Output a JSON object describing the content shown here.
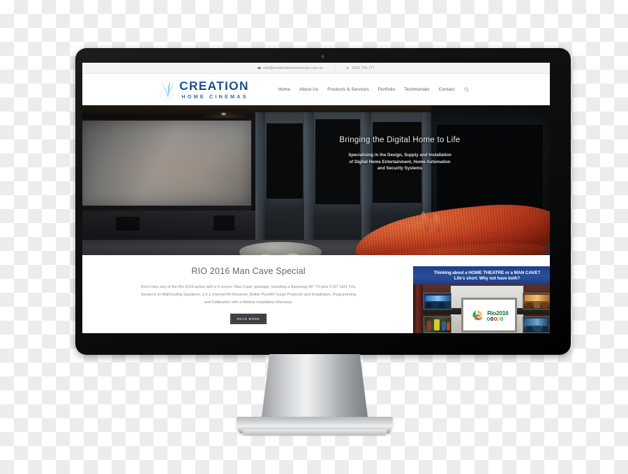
{
  "mockup": {
    "device": "desktop-monitor",
    "background": "transparency-checkerboard"
  },
  "site": {
    "topbar": {
      "email": "info@creationhomecinemas.com.au",
      "email_icon": "envelope-icon",
      "phone": "1300 739 777",
      "phone_icon": "phone-icon"
    },
    "logo": {
      "main": "CREATION",
      "sub": "HOME CINEMAS",
      "mark": "blue-swoosh-icon",
      "color": "#2f6fb5"
    },
    "nav": {
      "items": [
        {
          "label": "Home"
        },
        {
          "label": "About Us"
        },
        {
          "label": "Products & Services"
        },
        {
          "label": "Portfolio"
        },
        {
          "label": "Testimonials"
        },
        {
          "label": "Contact"
        }
      ],
      "search_icon": "search-icon"
    },
    "hero": {
      "title": "Bringing the Digital Home to Life",
      "sub_line1": "Specialising in the Design, Supply and Installation",
      "sub_line2": "of Digital Home Entertainment, Home Automation",
      "sub_line3": "and Security Systems",
      "image_alt": "dark-home-cinema-room-with-projection-screen-and-orange-lounge-chair"
    },
    "promo": {
      "title": "RIO 2016 Man Cave Special",
      "body_line1": "Don't miss any of the Rio 2016 action with a 5 screen 'Man Cave' package, including a Samsung 55\" TV plus 4 32\" LED TVs,",
      "body_line2": "Sonance In-Wall/Ceiling Speakers, a 5.1 channel AV Receiver, Belkin PureAV Surge Protector and Installation, Programming",
      "body_line3": "and Calibration with a lifetime Installation Warranty.",
      "button_label": "READ MORE",
      "button_color": "#3d3f44"
    },
    "banner": {
      "headline_pre": "Thinking about a ",
      "headline_b1": "HOME THEATRE",
      "headline_mid": " or a ",
      "headline_b2": "MAN CAVE?",
      "headline_line2": "Life's short. Why not have both?",
      "screen_logo_word": "Rio2016",
      "screen_logo_mark": "rio-2016-flame-icon",
      "rings_icon": "olympic-rings-icon",
      "bg_color": "#1f3f86",
      "thumbnails": [
        {
          "name": "tv-thumb-top-left"
        },
        {
          "name": "tv-thumb-bottom-left"
        },
        {
          "name": "tv-thumb-top-right"
        },
        {
          "name": "tv-thumb-bottom-right"
        }
      ]
    }
  }
}
